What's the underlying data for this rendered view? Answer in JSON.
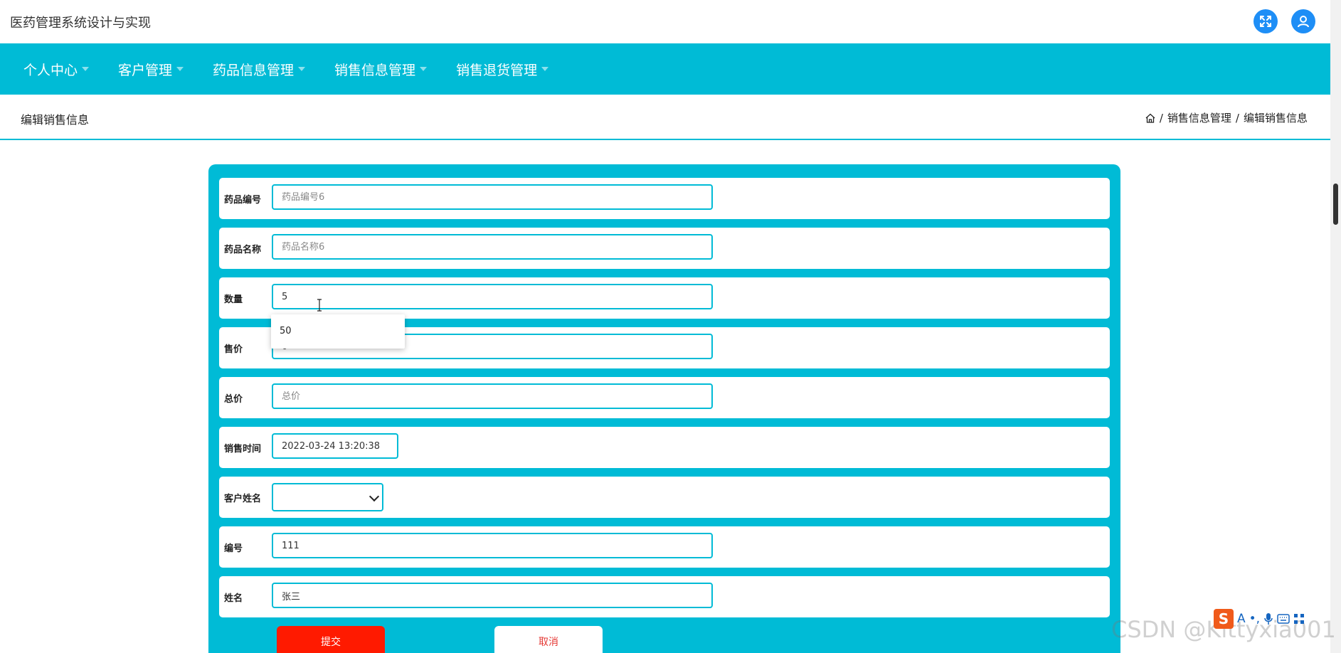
{
  "app": {
    "title": "医药管理系统设计与实现",
    "icons": [
      "fullscreen-icon",
      "user-icon"
    ],
    "accent": "#00bbd6",
    "brand_blue": "#1e8ef6"
  },
  "nav": {
    "items": [
      "个人中心",
      "客户管理",
      "药品信息管理",
      "销售信息管理",
      "销售退货管理"
    ]
  },
  "breadcrumb": {
    "page_title": "编辑销售信息",
    "home_icon": "home-icon",
    "separator": "/",
    "section": "销售信息管理",
    "current": "编辑销售信息"
  },
  "form": {
    "fields": [
      {
        "label": "药品编号",
        "value": "",
        "placeholder": "药品编号6"
      },
      {
        "label": "药品名称",
        "value": "",
        "placeholder": "药品名称6"
      },
      {
        "label": "数量",
        "value": "5",
        "placeholder": ""
      },
      {
        "label": "售价",
        "value": "0",
        "placeholder": ""
      },
      {
        "label": "总价",
        "value": "",
        "placeholder": "总价"
      },
      {
        "label": "销售时间",
        "value": "2022-03-24 13:20:38",
        "placeholder": ""
      },
      {
        "label": "客户姓名",
        "value": "",
        "placeholder": ""
      },
      {
        "label": "编号",
        "value": "111",
        "placeholder": ""
      },
      {
        "label": "姓名",
        "value": "张三",
        "placeholder": ""
      }
    ],
    "autocomplete_suggestion": "50",
    "submit_label": "提交",
    "cancel_label": "取消",
    "submit_color": "#ff1a00",
    "cancel_text_color": "#e53935"
  },
  "overlay": {
    "watermark": "CSDN @Kittyxia001",
    "ime_logo": "S",
    "ime_icons": [
      "A",
      "•,",
      "mic-icon",
      "keyboard-icon",
      "grid-icon"
    ]
  }
}
